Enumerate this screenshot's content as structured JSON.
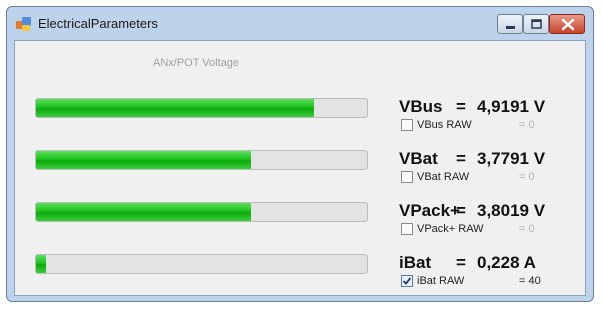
{
  "window": {
    "title": "ElectricalParameters"
  },
  "panel": {
    "header": "ANx/POT Voltage"
  },
  "params": [
    {
      "name": "VBus",
      "eq": "=",
      "value": "4,9191 V",
      "level_percent": 84,
      "raw_label": "VBus RAW",
      "raw_checked": false,
      "raw_value": "= 0"
    },
    {
      "name": "VBat",
      "eq": "=",
      "value": "3,7791 V",
      "level_percent": 65,
      "raw_label": "VBat RAW",
      "raw_checked": false,
      "raw_value": "= 0"
    },
    {
      "name": "VPack+",
      "eq": "=",
      "value": "3,8019 V",
      "level_percent": 65,
      "raw_label": "VPack+ RAW",
      "raw_checked": false,
      "raw_value": "= 0"
    },
    {
      "name": "iBat",
      "eq": "=",
      "value": "0,228 A",
      "level_percent": 3,
      "raw_label": "iBat RAW",
      "raw_checked": true,
      "raw_value": "= 40"
    }
  ]
}
